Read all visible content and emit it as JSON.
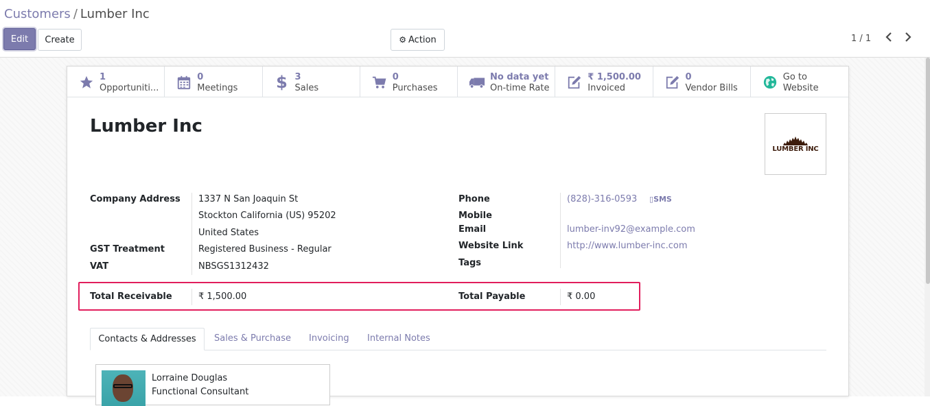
{
  "breadcrumb": {
    "parent": "Customers",
    "separator": "/",
    "current": "Lumber Inc"
  },
  "toolbar": {
    "edit": "Edit",
    "create": "Create",
    "action": "Action"
  },
  "pager": {
    "value": "1 / 1",
    "prev": "‹",
    "next": "›"
  },
  "stats": [
    {
      "num": "1",
      "label": "Opportuniti...",
      "icon": "star-icon"
    },
    {
      "num": "0",
      "label": "Meetings",
      "icon": "calendar-icon"
    },
    {
      "num": "3",
      "label": "Sales",
      "icon": "dollar-icon"
    },
    {
      "num": "0",
      "label": "Purchases",
      "icon": "cart-icon"
    },
    {
      "num": "No data yet",
      "label": "On-time Rate",
      "icon": "truck-icon"
    },
    {
      "num": "₹ 1,500.00",
      "label": "Invoiced",
      "icon": "pencil-square-icon"
    },
    {
      "num": "0",
      "label": "Vendor Bills",
      "icon": "pencil-square-icon"
    },
    {
      "num": "Go to",
      "label": "Website",
      "icon": "globe-icon"
    }
  ],
  "partner": {
    "name": "Lumber Inc",
    "logo_text": "LUMBER INC",
    "labels": {
      "company_address": "Company Address",
      "gst_treatment": "GST Treatment",
      "vat": "VAT",
      "total_receivable": "Total Receivable",
      "phone": "Phone",
      "mobile": "Mobile",
      "email": "Email",
      "website": "Website Link",
      "tags": "Tags",
      "total_payable": "Total Payable"
    },
    "address_line1": "1337 N San Joaquin St",
    "address_line2": "Stockton  California (US)  95202",
    "address_line3": "United States",
    "gst_treatment": "Registered Business - Regular",
    "vat": "NBSGS1312432",
    "total_receivable": "₹ 1,500.00",
    "phone": "(828)-316-0593",
    "sms": "SMS",
    "email": "lumber-inv92@example.com",
    "website": "http://www.lumber-inc.com",
    "total_payable": "₹ 0.00"
  },
  "tabs": [
    "Contacts & Addresses",
    "Sales & Purchase",
    "Invoicing",
    "Internal Notes"
  ],
  "contact": {
    "name": "Lorraine Douglas",
    "job": "Functional Consultant"
  },
  "colors": {
    "accent": "#7c7bad",
    "highlight": "#e11d5c"
  }
}
